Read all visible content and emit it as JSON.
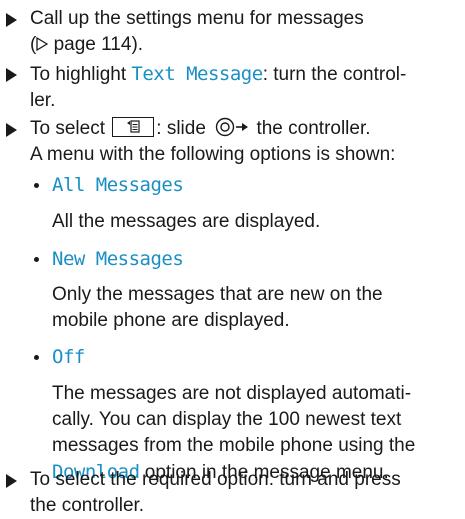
{
  "steps": [
    {
      "line1": "Call up the settings menu for messages",
      "line2_prefix": "(",
      "line2_ref": " page 114)."
    },
    {
      "pre": "To highlight ",
      "item": "Text Message",
      "post": ": turn the control-",
      "line2": "ler."
    },
    {
      "pre": "To select ",
      "mid": ": slide ",
      "post": " the controller.",
      "line2": "A menu with the following options is shown:"
    },
    {
      "line1": "To select the required option: turn and press",
      "line2": "the controller."
    }
  ],
  "options": [
    {
      "label": "All Messages",
      "desc_lines": [
        "All the messages are displayed."
      ]
    },
    {
      "label": "New Messages",
      "desc_lines": [
        "Only the messages that are new on the",
        "mobile phone are displayed."
      ]
    },
    {
      "label": "Off",
      "desc_lines": [
        "The messages are not displayed automati-",
        "cally. You can display the 100 newest text",
        "messages from the mobile phone using the"
      ],
      "desc_last_item": "Download",
      "desc_last_post": " option in the message menu."
    }
  ],
  "colors": {
    "text": "#1a1a1a",
    "highlight": "#1a8fc4"
  },
  "icons": {
    "bullet": "black-right-triangle",
    "page_ref": "outline-right-triangle",
    "menu_key": "menu-list-icon",
    "controller": "controller-knob-icon"
  }
}
